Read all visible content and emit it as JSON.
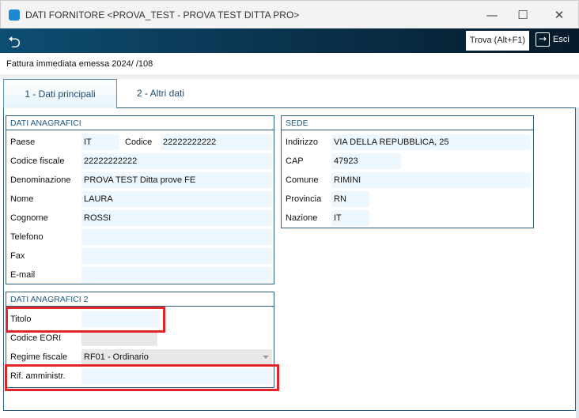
{
  "window": {
    "title": "DATI FORNITORE <PROVA_TEST - PROVA TEST DITTA PRO>",
    "minimize": "—",
    "maximize": "☐",
    "close": "✕"
  },
  "toolbar": {
    "back_icon": "undo-arrow-icon",
    "find_label": "Trova (Alt+F1)",
    "exit_label": "Esci"
  },
  "subtitle": "Fattura immediata emessa 2024/ /108",
  "tabs": [
    {
      "label": "1 - Dati principali",
      "active": true
    },
    {
      "label": "2 - Altri dati",
      "active": false
    }
  ],
  "anagrafici": {
    "title": "DATI ANAGRAFICI",
    "paese_label": "Paese",
    "paese": "IT",
    "codice_label": "Codice",
    "codice": "22222222222",
    "cf_label": "Codice fiscale",
    "cf": "22222222222",
    "denominazione_label": "Denominazione",
    "denominazione": "PROVA TEST Ditta prove FE",
    "nome_label": "Nome",
    "nome": "LAURA",
    "cognome_label": "Cognome",
    "cognome": "ROSSI",
    "telefono_label": "Telefono",
    "telefono": "",
    "fax_label": "Fax",
    "fax": "",
    "email_label": "E-mail",
    "email": ""
  },
  "anagrafici2": {
    "title": "DATI ANAGRAFICI 2",
    "titolo_label": "Titolo",
    "titolo": "",
    "eori_label": "Codice EORI",
    "eori": "",
    "regime_label": "Regime fiscale",
    "regime": "RF01 - Ordinario",
    "rif_label": "Rif. amministr.",
    "rif": ""
  },
  "sede": {
    "title": "SEDE",
    "indirizzo_label": "Indirizzo",
    "indirizzo": "VIA DELLA REPUBBLICA, 25",
    "cap_label": "CAP",
    "cap": "47923",
    "comune_label": "Comune",
    "comune": "RIMINI",
    "provincia_label": "Provincia",
    "provincia": "RN",
    "nazione_label": "Nazione",
    "nazione": "IT"
  },
  "highlight_color": "#e0262b"
}
